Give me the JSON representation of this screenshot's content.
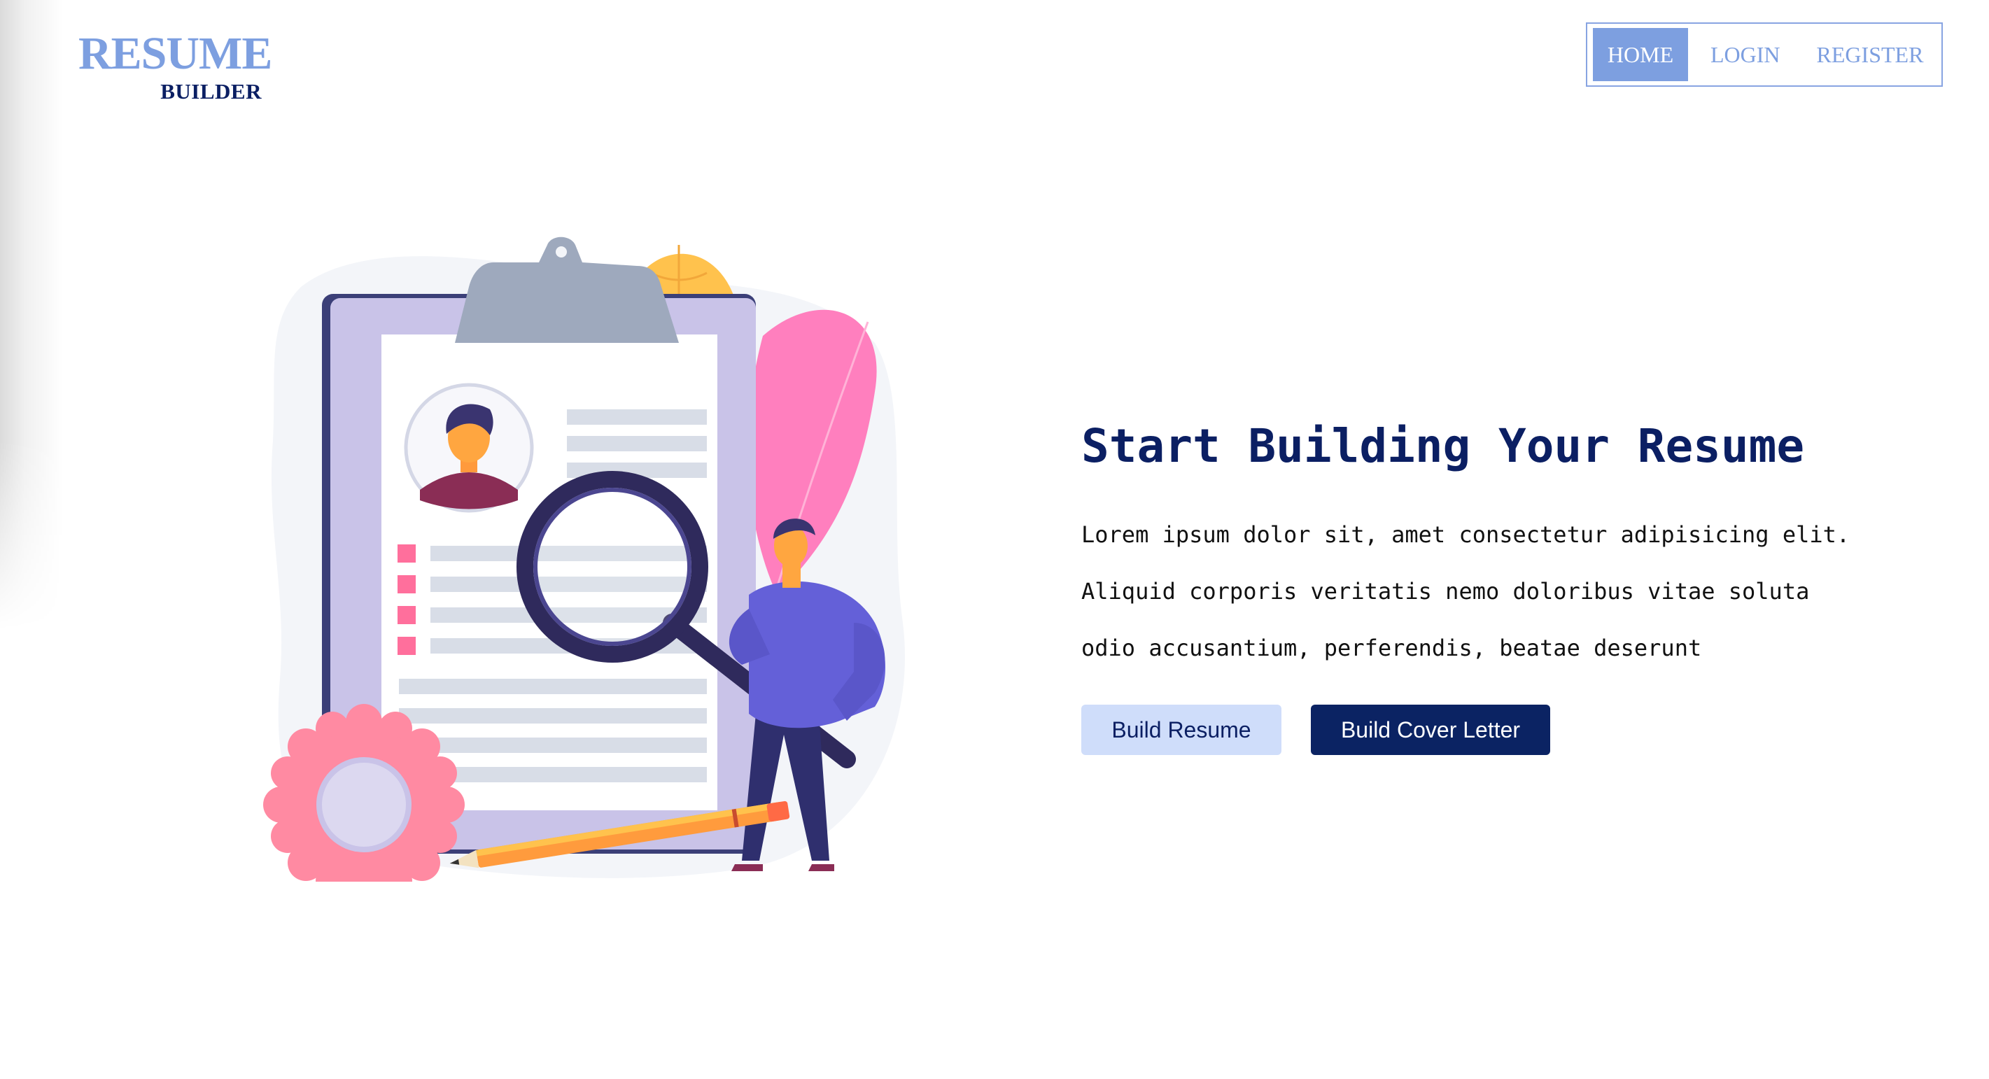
{
  "logo": {
    "main": "RESUME",
    "sub": "BUILDER"
  },
  "nav": {
    "items": [
      {
        "label": "HOME",
        "active": true
      },
      {
        "label": "LOGIN",
        "active": false
      },
      {
        "label": "REGISTER",
        "active": false
      }
    ]
  },
  "hero": {
    "title": "Start Building Your Resume",
    "description_lines": [
      "Lorem ipsum dolor sit, amet consectetur adipisicing elit.",
      "Aliquid corporis veritatis nemo doloribus vitae soluta",
      "odio accusantium, perferendis, beatae deserunt"
    ],
    "buttons": {
      "build_resume": "Build Resume",
      "build_cover_letter": "Build Cover Letter"
    }
  },
  "colors": {
    "brand_light": "#7d9fe0",
    "brand_dark": "#0b1f63",
    "button_light": "#cfddfa",
    "button_dark": "#0b2363"
  }
}
